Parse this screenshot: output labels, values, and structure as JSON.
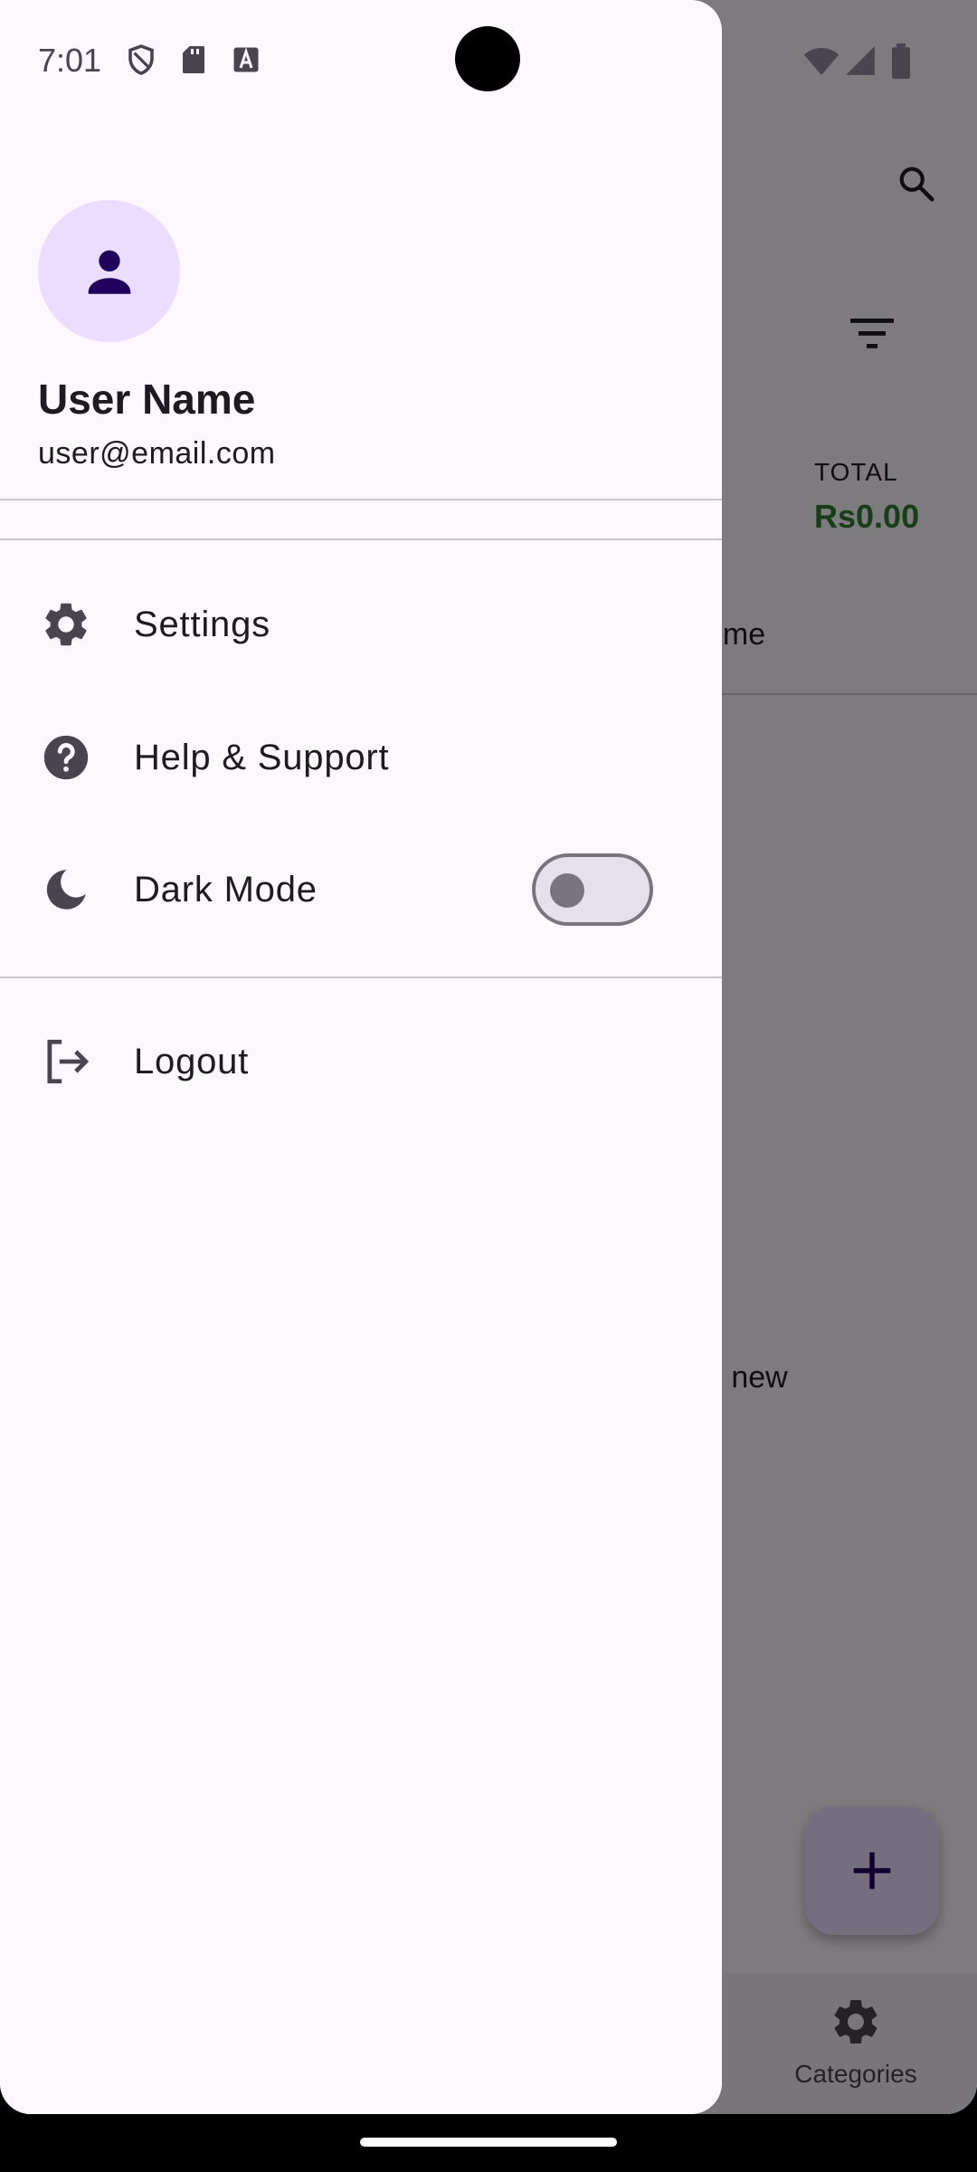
{
  "status_bar": {
    "time": "7:01",
    "left_icons": [
      "shield-icon",
      "sd-card-icon",
      "text-notification-icon"
    ],
    "right_icons": [
      "wifi-icon",
      "signal-icon",
      "battery-icon"
    ]
  },
  "background_app": {
    "total_label": "TOTAL",
    "total_value": "Rs0.00",
    "tab_partial": "ome",
    "empty_partial": "d new",
    "nav_label": "Categories",
    "colors": {
      "total_value": "#2e7d32",
      "fab": "#eaddff"
    }
  },
  "drawer": {
    "user_name": "User Name",
    "user_email": "user@email.com",
    "menu": [
      {
        "label": "Settings",
        "icon": "gear-icon"
      },
      {
        "label": "Help & Support",
        "icon": "help-circle-icon"
      },
      {
        "label": "Dark Mode",
        "icon": "moon-icon",
        "toggle_on": false
      }
    ],
    "logout_label": "Logout",
    "colors": {
      "background": "#fdf7ff",
      "avatar": "#eaddff",
      "avatar_icon": "#21005d"
    }
  }
}
